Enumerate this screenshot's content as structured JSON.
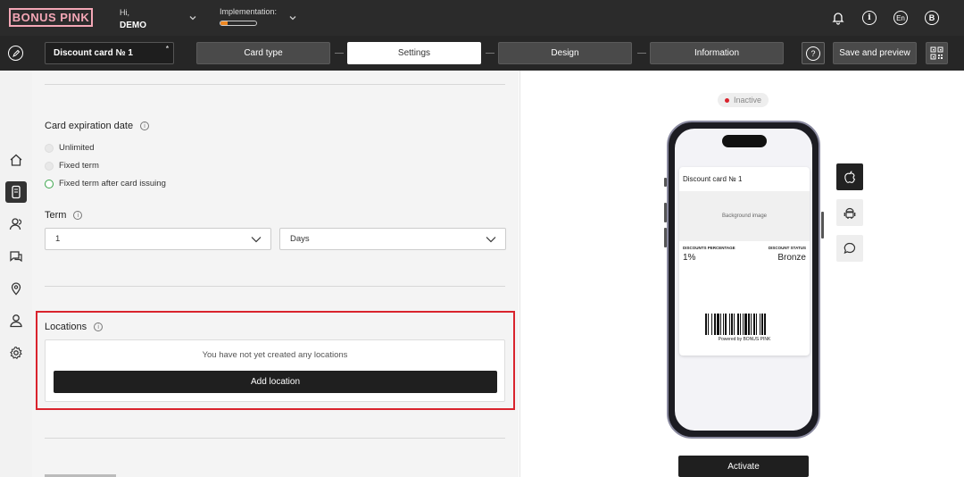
{
  "header": {
    "logo": "BONUS PINK",
    "greeting": "Hi,",
    "user": "DEMO",
    "implementation_label": "Implementation:",
    "implementation_progress": 0.2,
    "language": "En",
    "avatar_letter": "B",
    "accent_color": "#f4a7b6"
  },
  "toolbar": {
    "card_name": "Discount card № 1",
    "required_mark": "*",
    "steps": [
      "Card type",
      "Settings",
      "Design",
      "Information"
    ],
    "active_step": "Settings",
    "help_label": "?",
    "save_label": "Save and preview"
  },
  "sidebar": {
    "items": [
      "home-icon",
      "card-icon",
      "users-icon",
      "chat-icon",
      "location-icon",
      "person-icon",
      "gear-icon"
    ],
    "active": "card-icon"
  },
  "settings": {
    "expiration": {
      "title": "Card expiration date",
      "options": [
        "Unlimited",
        "Fixed term",
        "Fixed term after card issuing"
      ],
      "selected": "Fixed term after card issuing"
    },
    "term": {
      "title": "Term",
      "value": "1",
      "unit": "Days"
    },
    "locations": {
      "title": "Locations",
      "empty_text": "You have not yet created any locations",
      "add_label": "Add location"
    }
  },
  "preview": {
    "status": "Inactive",
    "status_color": "#d9232d",
    "pass": {
      "title": "Discount card № 1",
      "background_label": "Background image",
      "left_label": "DISCOUNTS PERCENTAGE",
      "left_value": "1%",
      "right_label": "DISCOUNT STATUS",
      "right_value": "Bronze",
      "powered_by": "Powered by BONUS PINK"
    },
    "platforms": [
      "apple-icon",
      "android-icon",
      "message-icon"
    ],
    "active_platform": "apple-icon",
    "activate_label": "Activate"
  }
}
